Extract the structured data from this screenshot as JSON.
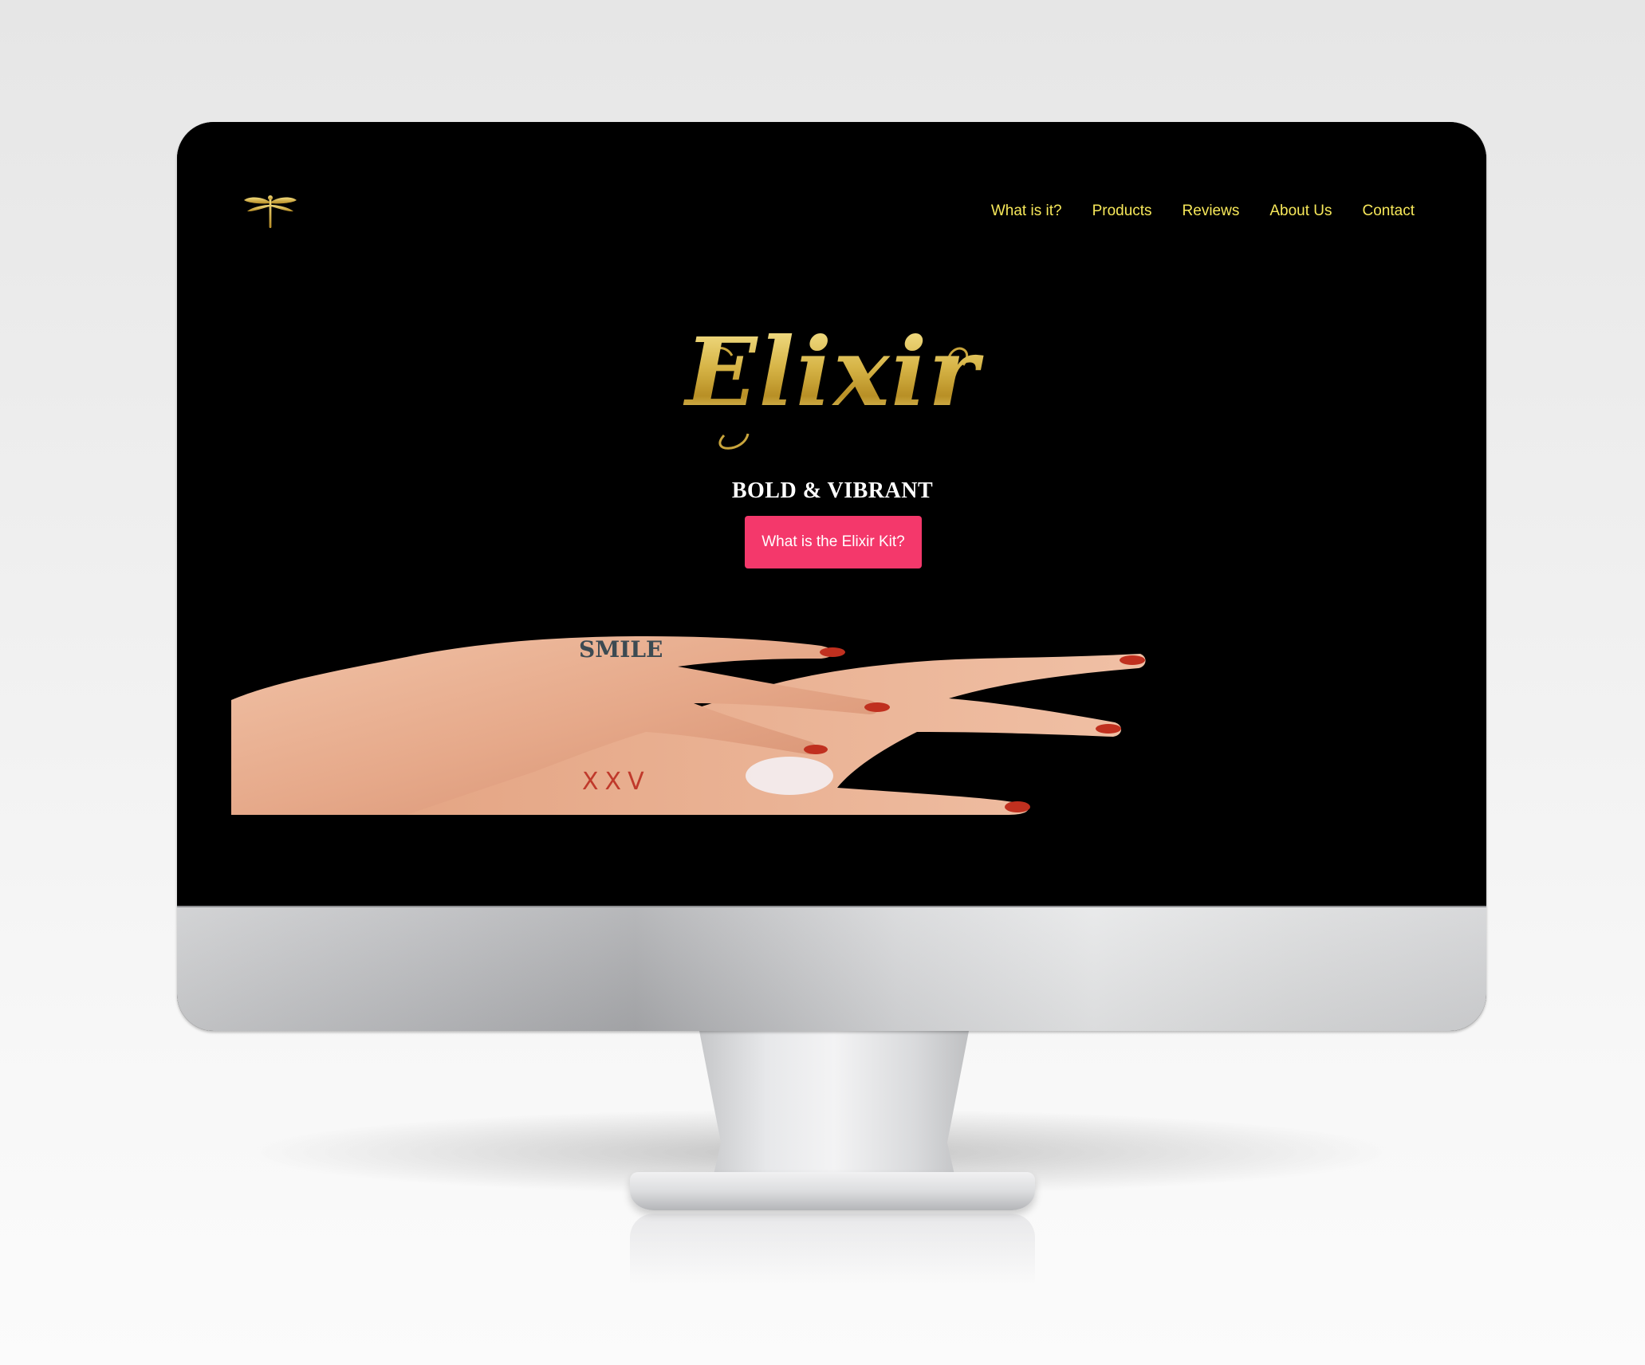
{
  "colors": {
    "nav_link": "#f7e85a",
    "gold": "#d6b446",
    "cta_background": "#f4386b",
    "cta_text": "#ffffff",
    "screen_background": "#000000",
    "tagline": "#ffffff"
  },
  "site": {
    "logo_icon": "dragonfly-icon",
    "nav": [
      {
        "label": "What is it?"
      },
      {
        "label": "Products"
      },
      {
        "label": "Reviews"
      },
      {
        "label": "About Us"
      },
      {
        "label": "Contact"
      }
    ],
    "hero": {
      "title": "Elixir",
      "tagline": "BOLD & VIBRANT",
      "cta_label": "What is the Elixir Kit?"
    },
    "hero_image": {
      "tattoo_finger": "SMILE",
      "tattoo_hand": "XXV"
    }
  }
}
